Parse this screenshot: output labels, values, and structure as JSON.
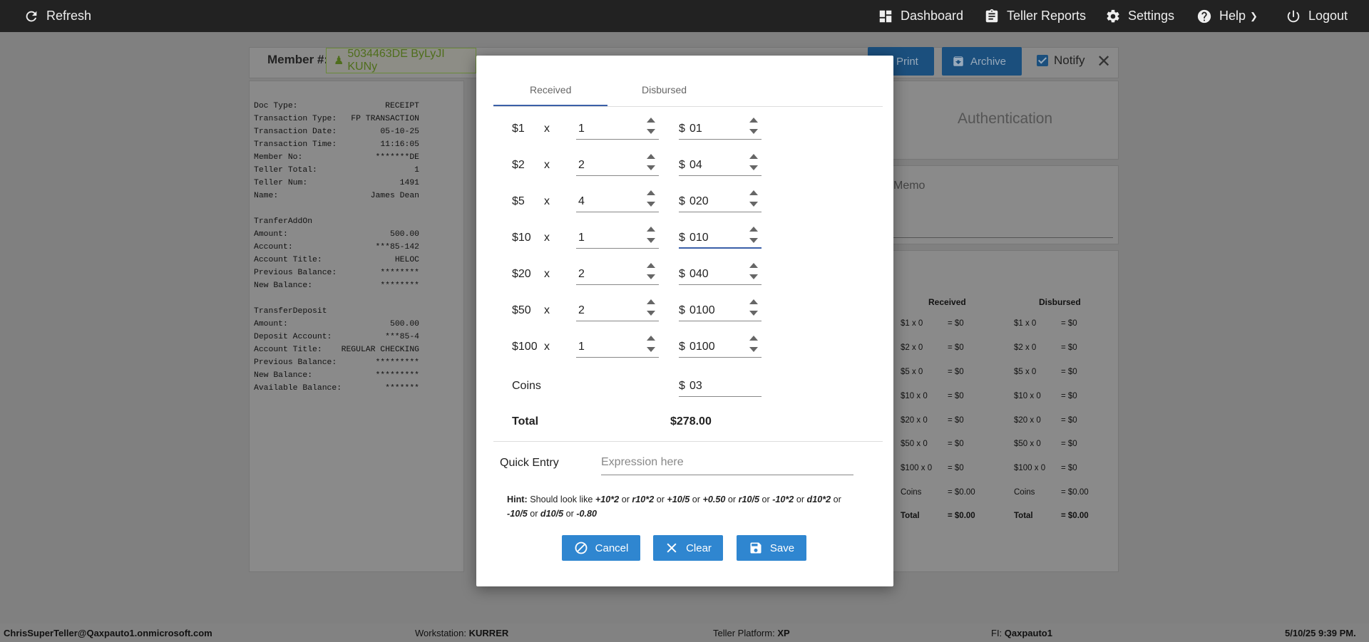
{
  "topbar": {
    "refresh": "Refresh",
    "dashboard": "Dashboard",
    "teller_reports": "Teller Reports",
    "settings": "Settings",
    "help": "Help",
    "logout": "Logout"
  },
  "background": {
    "member_label": "Member #:",
    "member_value": "5034463DE ByLyJI KUNy",
    "print": "Print",
    "archive": "Archive",
    "notify": "Notify",
    "receipt": [
      [
        "Doc Type:",
        "RECEIPT"
      ],
      [
        "Transaction Type:",
        "FP TRANSACTION"
      ],
      [
        "Transaction Date:",
        "05-10-25"
      ],
      [
        "Transaction Time:",
        "11:16:05"
      ],
      [
        "Member No:",
        "*******DE"
      ],
      [
        "Teller Total:",
        "1"
      ],
      [
        "Teller Num:",
        "1491"
      ],
      [
        "Name:",
        "James Dean"
      ],
      [
        "",
        ""
      ],
      [
        "TranferAddOn",
        ""
      ],
      [
        "Amount:",
        "500.00"
      ],
      [
        "Account:",
        "***85-142"
      ],
      [
        "Account Title:",
        "HELOC"
      ],
      [
        "Previous Balance:",
        "********"
      ],
      [
        "New Balance:",
        "********"
      ],
      [
        "",
        ""
      ],
      [
        "TransferDeposit",
        ""
      ],
      [
        "Amount:",
        "500.00"
      ],
      [
        "Deposit Account:",
        "***85-4"
      ],
      [
        "Account Title:",
        "REGULAR CHECKING"
      ],
      [
        "Previous Balance:",
        "*********"
      ],
      [
        "New Balance:",
        "*********"
      ],
      [
        "Available Balance:",
        "*******"
      ]
    ],
    "authentication": "Authentication",
    "memo": "Memo",
    "summary": {
      "received_header": "Received",
      "disbursed_header": "Disbursed",
      "received": [
        [
          "$1 x 0",
          "= $0"
        ],
        [
          "$2 x 0",
          "= $0"
        ],
        [
          "$5 x 0",
          "= $0"
        ],
        [
          "$10 x 0",
          "= $0"
        ],
        [
          "$20 x 0",
          "= $0"
        ],
        [
          "$50 x 0",
          "= $0"
        ],
        [
          "$100 x 0",
          "= $0"
        ],
        [
          "Coins",
          "= $0.00"
        ],
        [
          "Total",
          "= $0.00"
        ]
      ],
      "disbursed": [
        [
          "$1 x 0",
          "= $0"
        ],
        [
          "$2 x 0",
          "= $0"
        ],
        [
          "$5 x 0",
          "= $0"
        ],
        [
          "$10 x 0",
          "= $0"
        ],
        [
          "$20 x 0",
          "= $0"
        ],
        [
          "$50 x 0",
          "= $0"
        ],
        [
          "$100 x 0",
          "= $0"
        ],
        [
          "Coins",
          "= $0.00"
        ],
        [
          "Total",
          "= $0.00"
        ]
      ]
    }
  },
  "modal": {
    "tabs": {
      "received": "Received",
      "disbursed": "Disbursed"
    },
    "rows": [
      {
        "denom": "$1",
        "x": "x",
        "qty": "1",
        "prefix": "$",
        "amount": "01"
      },
      {
        "denom": "$2",
        "x": "x",
        "qty": "2",
        "prefix": "$",
        "amount": "04"
      },
      {
        "denom": "$5",
        "x": "x",
        "qty": "4",
        "prefix": "$",
        "amount": "020"
      },
      {
        "denom": "$10",
        "x": "x",
        "qty": "1",
        "prefix": "$",
        "amount": "010"
      },
      {
        "denom": "$20",
        "x": "x",
        "qty": "2",
        "prefix": "$",
        "amount": "040"
      },
      {
        "denom": "$50",
        "x": "x",
        "qty": "2",
        "prefix": "$",
        "amount": "0100"
      },
      {
        "denom": "$100",
        "x": "x",
        "qty": "1",
        "prefix": "$",
        "amount": "0100"
      }
    ],
    "coins_label": "Coins",
    "coins_prefix": "$",
    "coins_value": "03",
    "total_label": "Total",
    "total_value": "$278.00",
    "quick_entry_label": "Quick Entry",
    "quick_entry_placeholder": "Expression here",
    "hint": {
      "label": "Hint:",
      "text": "Should look like",
      "examples": [
        "+10*2",
        "r10*2",
        "+10/5",
        "+0.50",
        "r10/5",
        "-10*2",
        "d10*2",
        "-10/5",
        "d10/5",
        "-0.80"
      ],
      "or": "or"
    },
    "cancel": "Cancel",
    "clear": "Clear",
    "save": "Save"
  },
  "footer": {
    "user": "ChrisSuperTeller@Qaxpauto1.onmicrosoft.com",
    "workstation_label": "Workstation:",
    "workstation": "KURRER",
    "platform_label": "Teller Platform:",
    "platform": "XP",
    "fi_label": "FI:",
    "fi": "Qaxpauto1",
    "datetime": "5/10/25 9:39 PM."
  }
}
